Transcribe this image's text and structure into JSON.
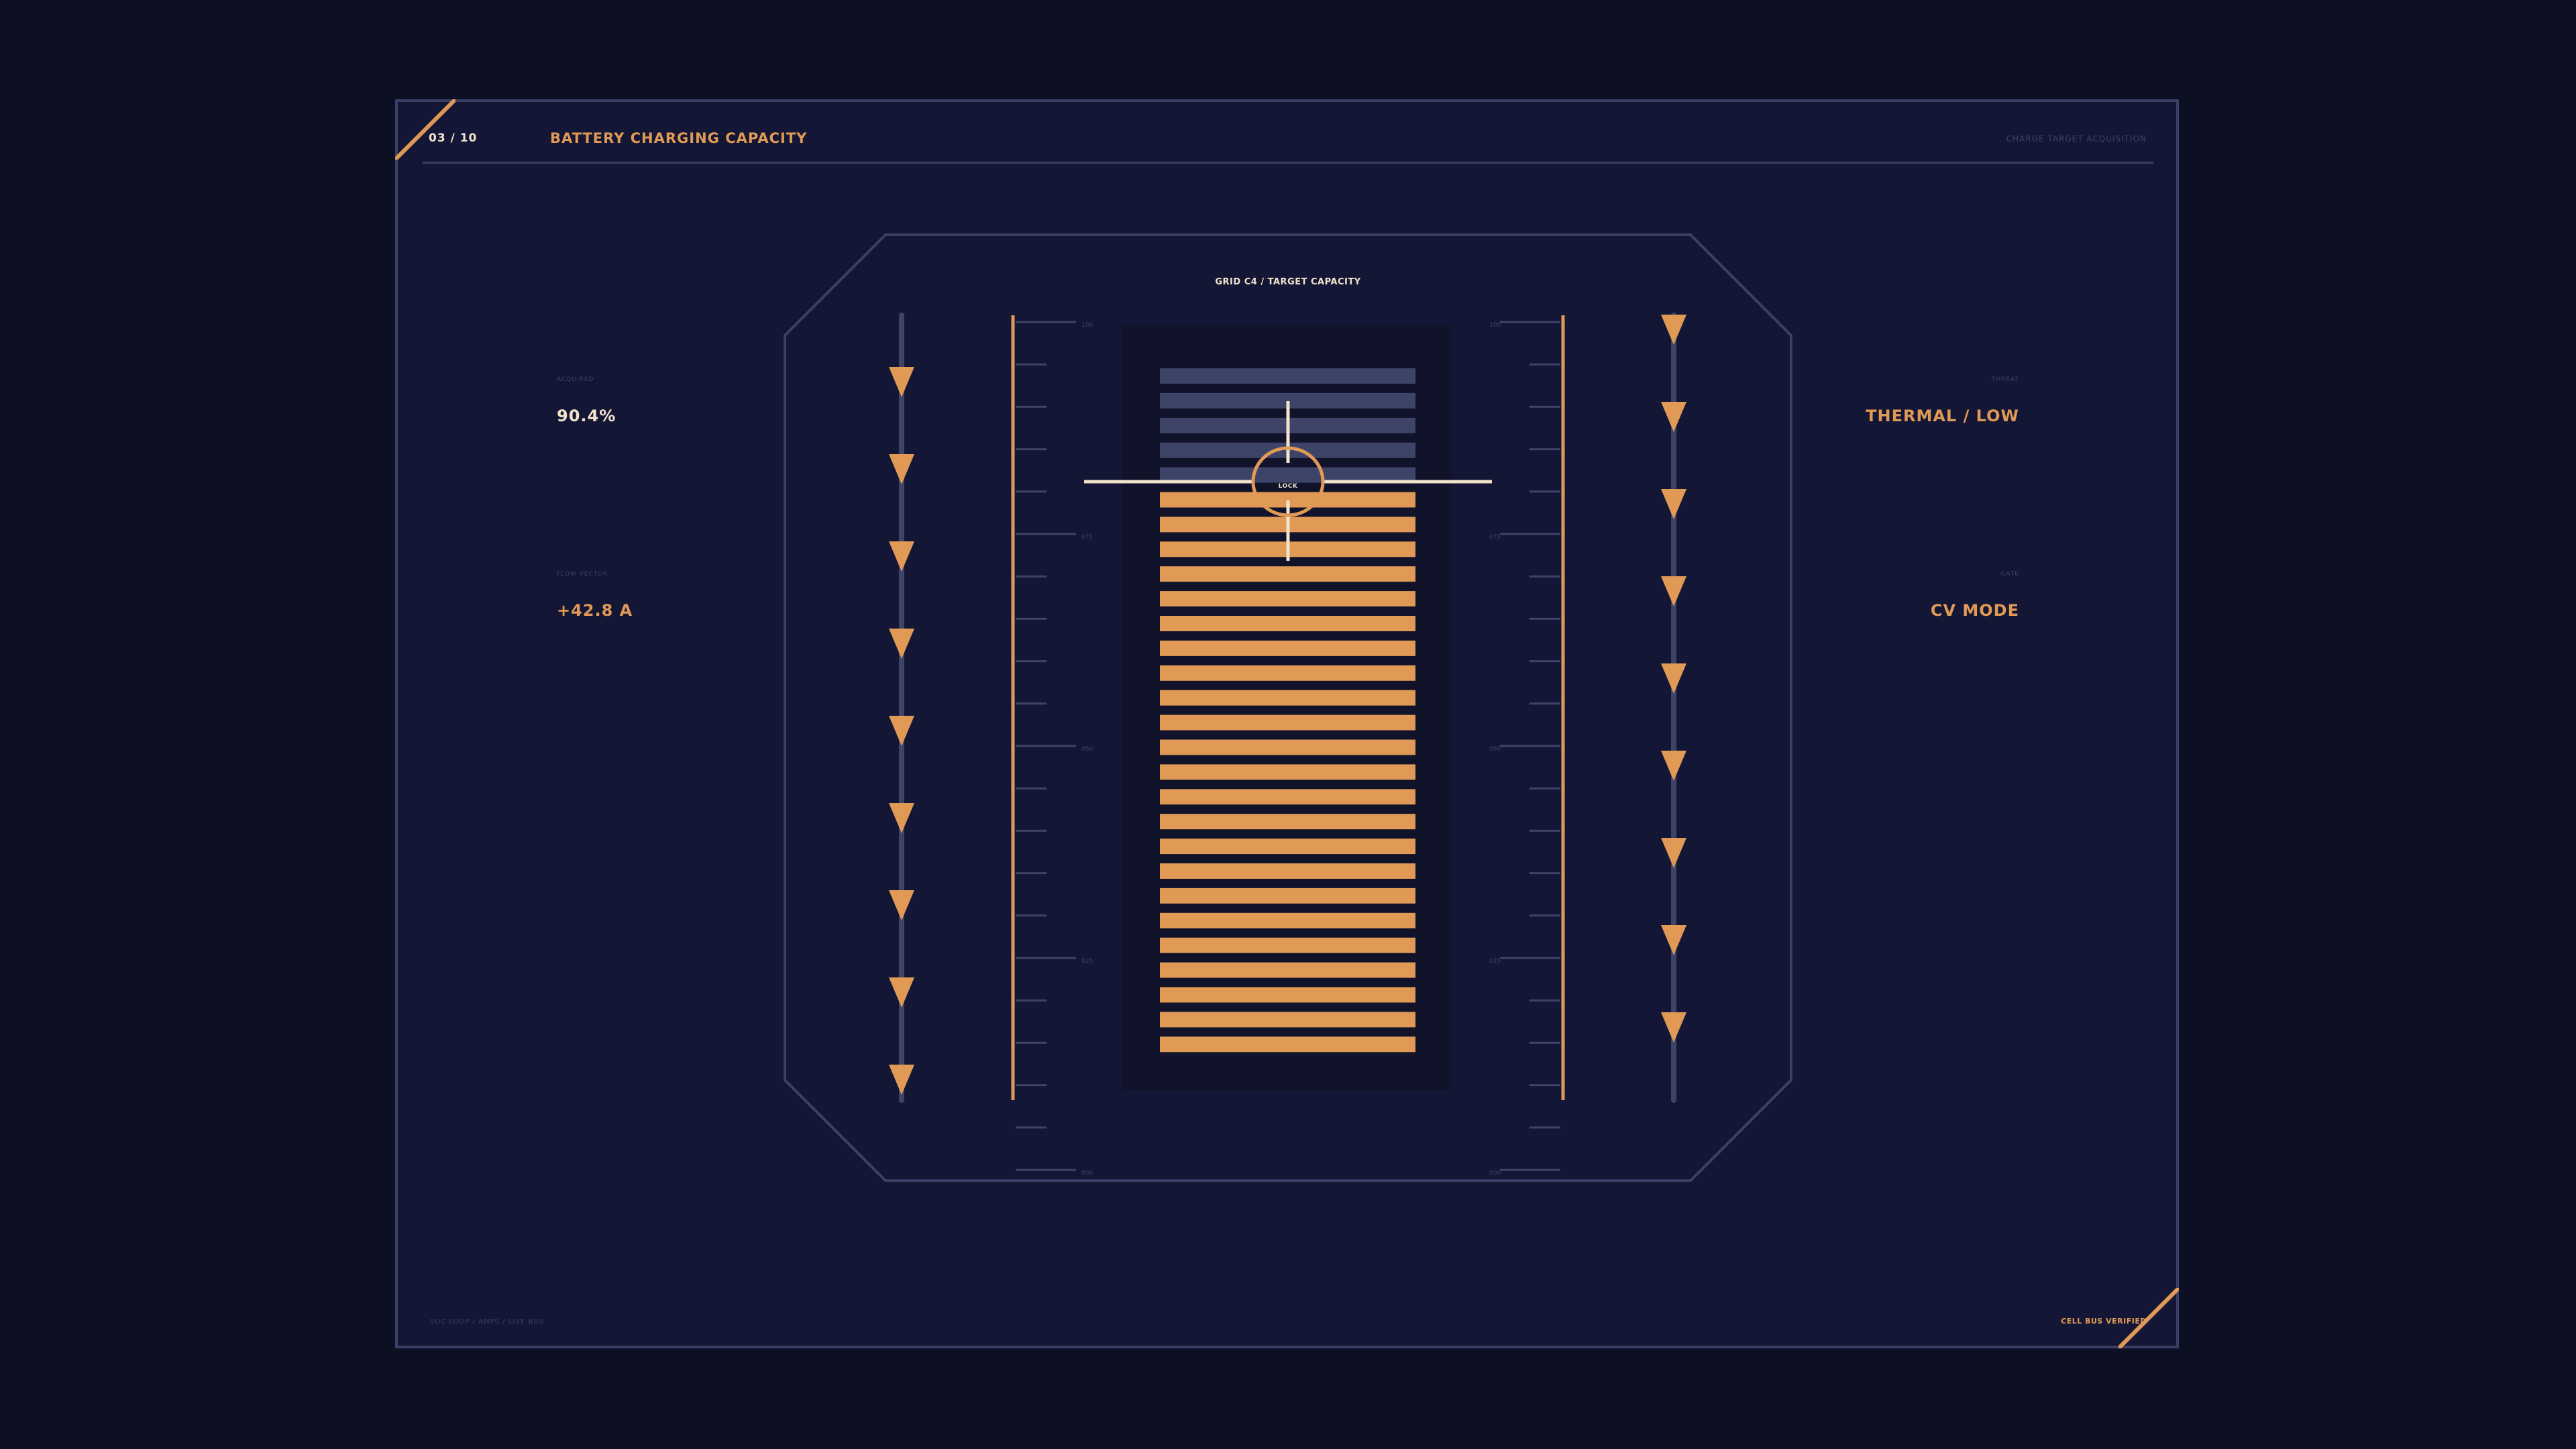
{
  "header": {
    "page_indicator": "03 / 10",
    "title": "BATTERY CHARGING CAPACITY",
    "right_label": "CHARGE TARGET ACQUISITION"
  },
  "footer": {
    "left_label": "SOC LOOP / AMPS / LIVE BUS",
    "right_label": "CELL BUS VERIFIED"
  },
  "left_panel": {
    "acquired_label": "ACQUIRED",
    "acquired_value": "90.4%",
    "flow_label": "FLOW VECTOR",
    "flow_value": "+42.8 A"
  },
  "right_panel": {
    "threat_label": "THREAT",
    "threat_value": "THERMAL / LOW",
    "gate_label": "GATE",
    "gate_value": "CV MODE"
  },
  "gauge": {
    "title": "GRID C4 / TARGET CAPACITY",
    "lock_label": "LOCK",
    "total_segments": 28,
    "filled_segments": 23,
    "left_scale_labels": [
      "100",
      "075",
      "050",
      "025",
      "000"
    ],
    "right_scale_labels": [
      "100",
      "075",
      "050",
      "025",
      "000"
    ]
  },
  "colors": {
    "background": "#0d0f23",
    "panel": "#141636",
    "accent": "#e09a55",
    "muted": "#3a3f66",
    "text_light": "#f1e3cc"
  }
}
